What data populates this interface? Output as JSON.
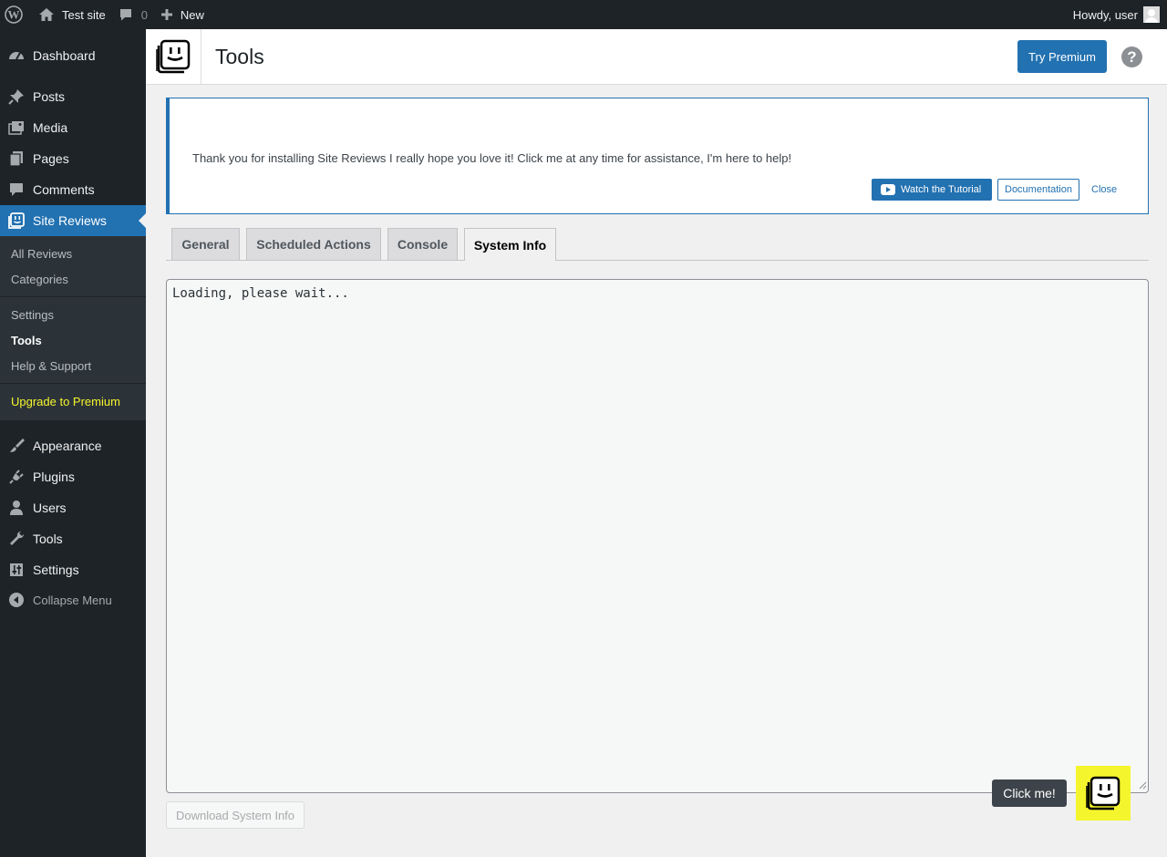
{
  "adminbar": {
    "site_name": "Test site",
    "comment_count": "0",
    "new_label": "New",
    "howdy": "Howdy, user"
  },
  "sidebar": {
    "items": [
      {
        "label": "Dashboard",
        "icon": "dashboard-icon"
      },
      {
        "label": "Posts",
        "icon": "pin-icon"
      },
      {
        "label": "Media",
        "icon": "media-icon"
      },
      {
        "label": "Pages",
        "icon": "pages-icon"
      },
      {
        "label": "Comments",
        "icon": "comments-icon"
      },
      {
        "label": "Site Reviews",
        "icon": "site-reviews-icon"
      },
      {
        "label": "Appearance",
        "icon": "brush-icon"
      },
      {
        "label": "Plugins",
        "icon": "plug-icon"
      },
      {
        "label": "Users",
        "icon": "user-icon"
      },
      {
        "label": "Tools",
        "icon": "wrench-icon"
      },
      {
        "label": "Settings",
        "icon": "sliders-icon"
      },
      {
        "label": "Collapse Menu",
        "icon": "collapse-icon"
      }
    ],
    "submenu": [
      "All Reviews",
      "Categories",
      "Settings",
      "Tools",
      "Help & Support",
      "Upgrade to Premium"
    ],
    "current_submenu": "Tools"
  },
  "header": {
    "title": "Tools",
    "try_premium": "Try Premium",
    "help_glyph": "?"
  },
  "notice": {
    "message": "Thank you for installing Site Reviews I really hope you love it! Click me at any time for assistance, I'm here to help!",
    "watch_tutorial": "Watch the Tutorial",
    "documentation": "Documentation",
    "close": "Close"
  },
  "tabs": [
    "General",
    "Scheduled Actions",
    "Console",
    "System Info"
  ],
  "active_tab": "System Info",
  "system_info": {
    "text": "Loading, please wait...",
    "download_label": "Download System Info"
  },
  "assistant": {
    "tooltip": "Click me!",
    "bubble_color": "#f5f52d"
  },
  "colors": {
    "accent": "#2271b1",
    "admin_dark": "#1d2327",
    "highlight": "#f5f52d"
  }
}
